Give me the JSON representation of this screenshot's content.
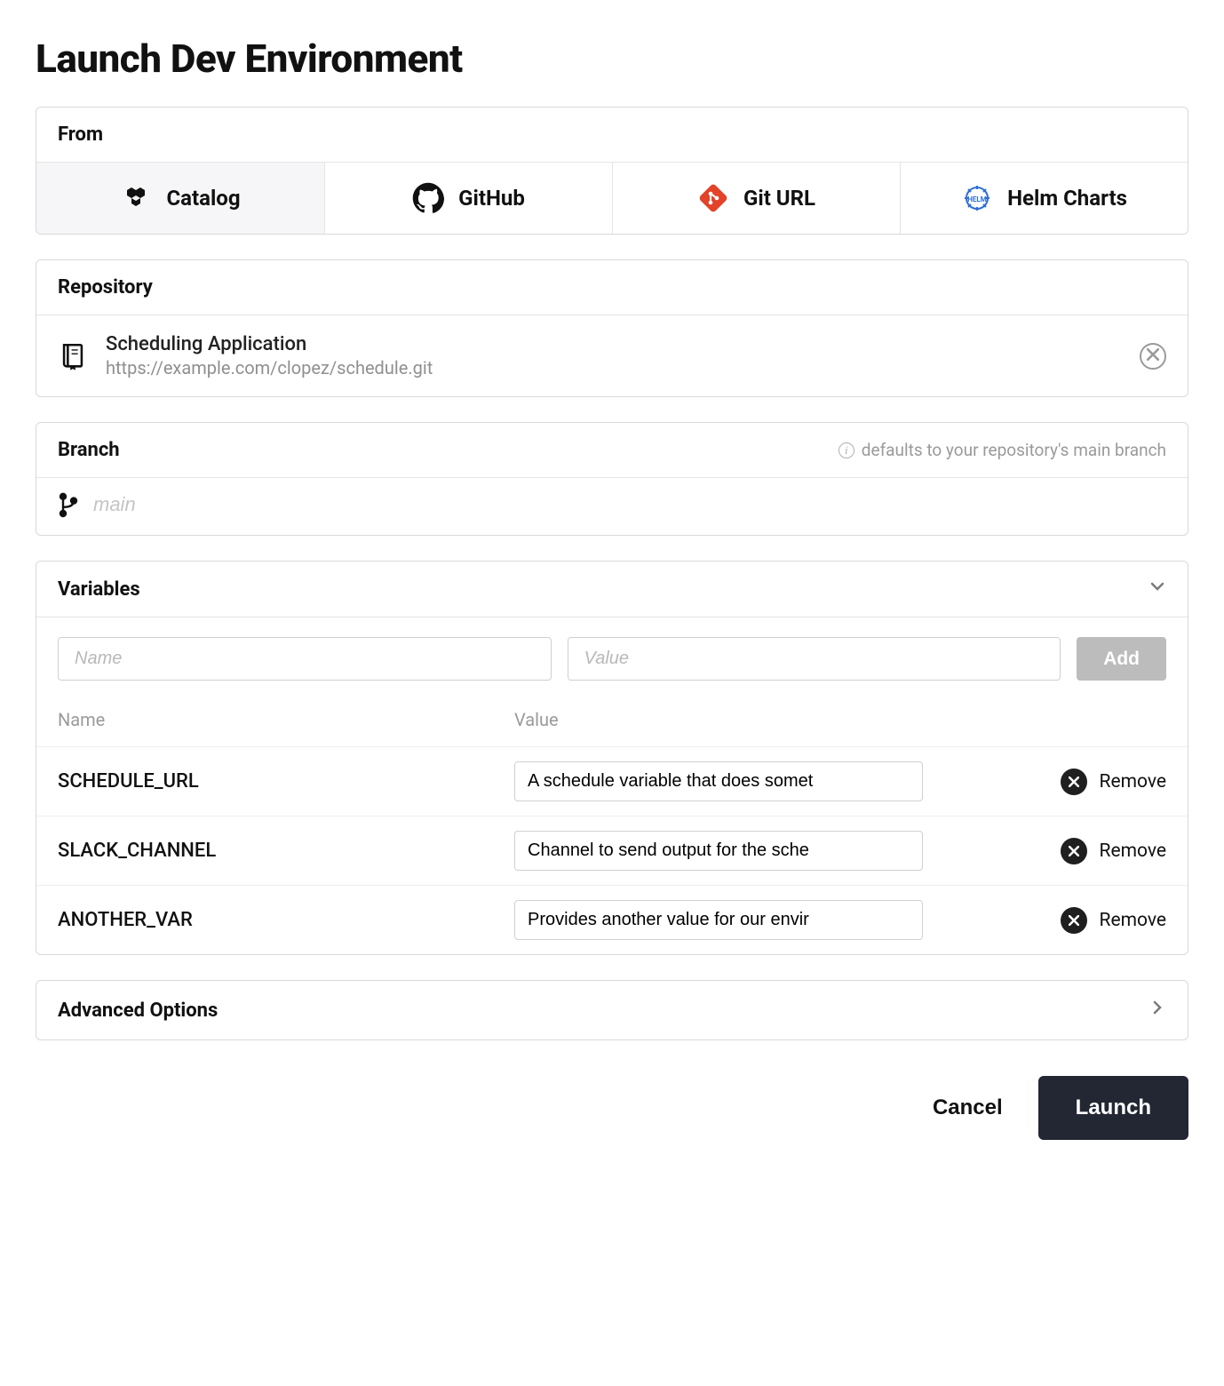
{
  "title": "Launch Dev Environment",
  "from": {
    "label": "From",
    "tabs": [
      {
        "label": "Catalog",
        "active": true
      },
      {
        "label": "GitHub",
        "active": false
      },
      {
        "label": "Git URL",
        "active": false
      },
      {
        "label": "Helm Charts",
        "active": false
      }
    ]
  },
  "repository": {
    "label": "Repository",
    "name": "Scheduling Application",
    "url": "https://example.com/clopez/schedule.git"
  },
  "branch": {
    "label": "Branch",
    "hint": "defaults to your repository's main branch",
    "placeholder": "main",
    "value": ""
  },
  "variables": {
    "label": "Variables",
    "name_placeholder": "Name",
    "value_placeholder": "Value",
    "add_label": "Add",
    "columns": {
      "name": "Name",
      "value": "Value"
    },
    "remove_label": "Remove",
    "rows": [
      {
        "name": "SCHEDULE_URL",
        "value": "A schedule variable that does somet"
      },
      {
        "name": "SLACK_CHANNEL",
        "value": "Channel to send output for the sche"
      },
      {
        "name": "ANOTHER_VAR",
        "value": "Provides another value for our envir"
      }
    ]
  },
  "advanced": {
    "label": "Advanced Options"
  },
  "footer": {
    "cancel": "Cancel",
    "launch": "Launch"
  }
}
